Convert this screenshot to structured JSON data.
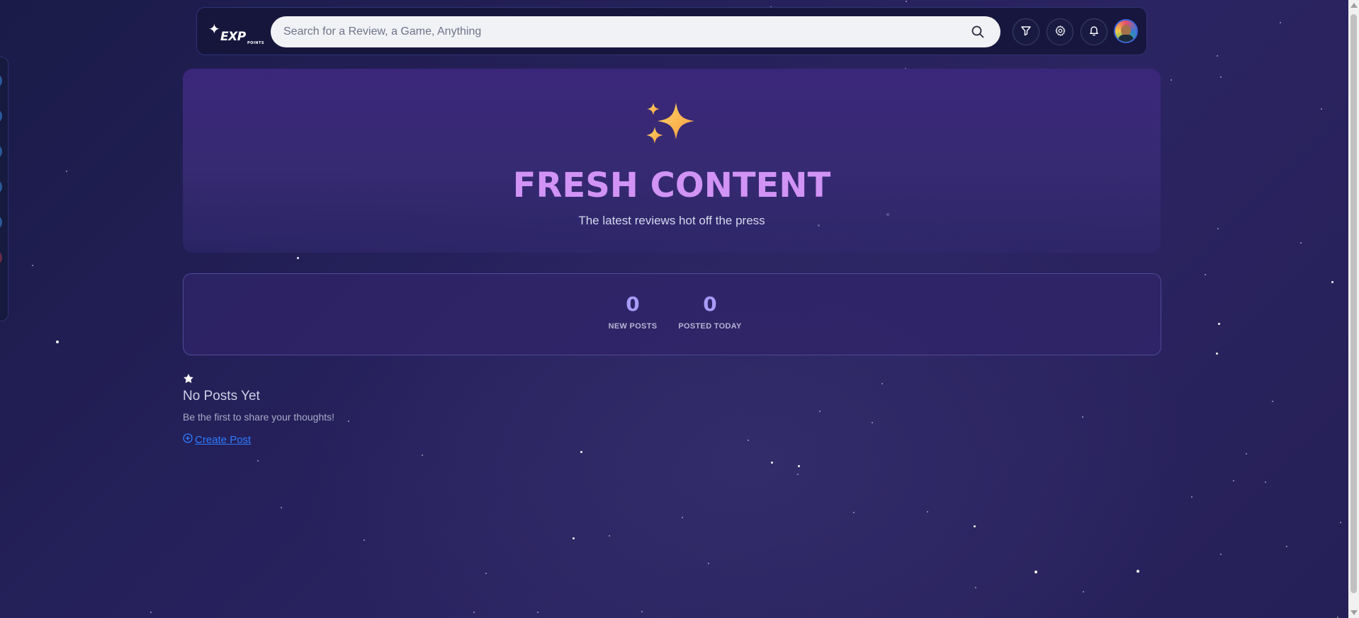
{
  "header": {
    "logo_text": "EXP",
    "logo_sub": "POINTS",
    "search_placeholder": "Search for a Review, a Game, Anything",
    "icons": [
      "filter-icon",
      "gear-icon",
      "bell-icon"
    ]
  },
  "hero": {
    "icon": "sparkles-icon",
    "title": "FRESH CONTENT",
    "subtitle": "The latest reviews hot off the press"
  },
  "stats": [
    {
      "value": "0",
      "label": "NEW POSTS"
    },
    {
      "value": "0",
      "label": "POSTED TODAY"
    }
  ],
  "empty_state": {
    "icon": "star-icon",
    "title": "No Posts Yet",
    "description": "Be the first to share your thoughts!",
    "cta_label": "Create Post"
  },
  "colors": {
    "accent_title": "#d193f5",
    "stat_value": "#a89bf8",
    "link": "#2f7dff"
  }
}
